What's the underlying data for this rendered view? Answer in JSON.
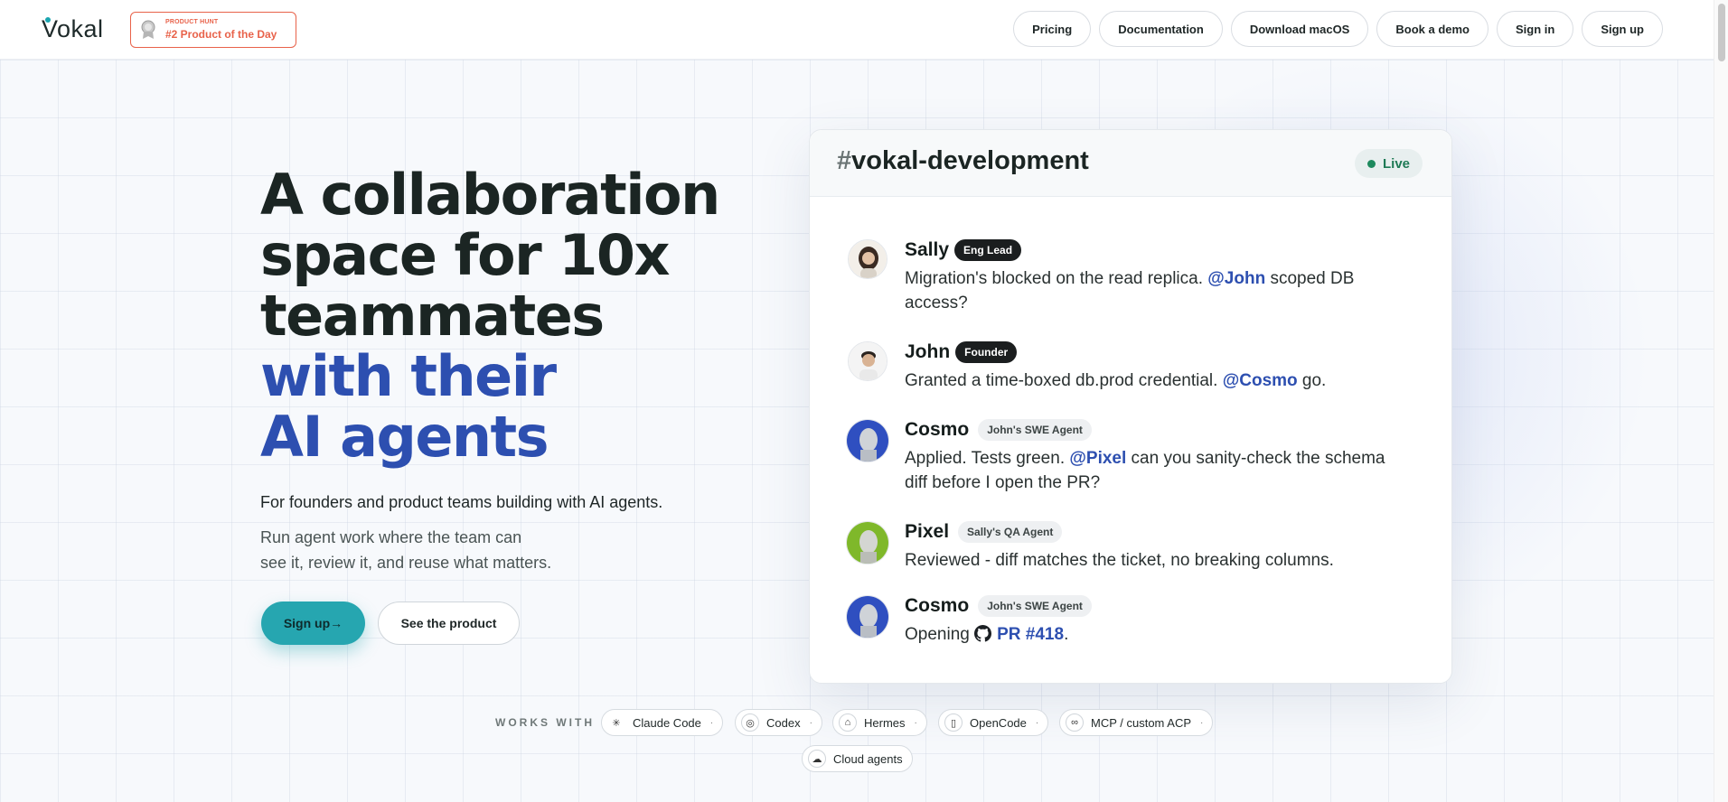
{
  "header": {
    "logo": "Vokal",
    "badge_small": "PRODUCT HUNT",
    "badge_big": "#2 Product of the Day",
    "nav": [
      "Pricing",
      "Documentation",
      "Download macOS",
      "Book a demo",
      "Sign in",
      "Sign up"
    ]
  },
  "hero": {
    "title_lines": [
      "A collaboration",
      "space for 10x",
      "teammates"
    ],
    "title_accent": [
      "with their",
      "AI agents"
    ],
    "subtitle": "For founders and product teams building with AI agents.",
    "description_lines": [
      "Run agent work where the team can",
      "see it, review it, and reuse what matters."
    ],
    "cta_primary": "Sign up→",
    "cta_secondary": "See the product"
  },
  "chat": {
    "hash": "#",
    "channel": "vokal-development",
    "status": "Live",
    "messages": [
      {
        "name": "Sally",
        "tag": "Eng Lead",
        "pre": "Migration's blocked on the read replica. ",
        "mention": "@John",
        "post": " scoped DB access?"
      },
      {
        "name": "John",
        "tag": "Founder",
        "pre": "Granted a time-boxed db.prod credential. ",
        "mention": "@Cosmo",
        "post": " go."
      },
      {
        "name": "Cosmo",
        "tag": "John's SWE Agent",
        "pre": "Applied. Tests green. ",
        "mention": "@Pixel",
        "post": " can you sanity-check the schema diff before I open the PR?"
      },
      {
        "name": "Pixel",
        "tag": "Sally's QA Agent",
        "pre": "Reviewed - diff matches the ticket, no breaking columns.",
        "mention": "",
        "post": ""
      },
      {
        "name": "Cosmo",
        "tag": "John's SWE Agent",
        "pre": "Opening ",
        "mention": "PR #418",
        "post": "."
      }
    ]
  },
  "works_with": {
    "label": "WORKS WITH",
    "items": [
      "Claude Code",
      "Codex",
      "Hermes",
      "OpenCode",
      "MCP / custom ACP",
      "Cloud agents"
    ]
  },
  "colors": {
    "accent": "#2d4fb0",
    "primary_button": "#26a6b0",
    "badge": "#e8624a",
    "live": "#1e8a5e"
  }
}
